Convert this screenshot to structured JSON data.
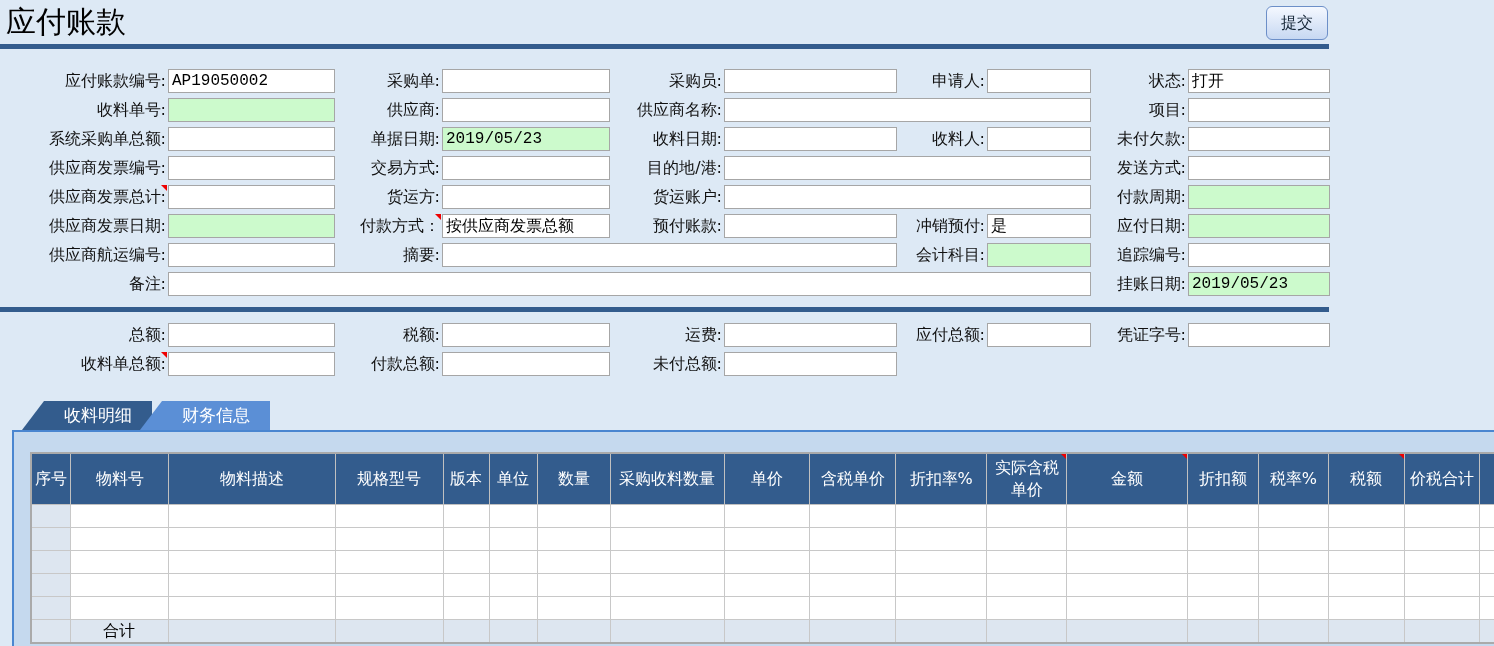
{
  "title": "应付账款",
  "submit_button": "提交",
  "form_rows": [
    [
      {
        "label": "应付账款编号:",
        "value": "AP19050002"
      },
      {
        "label": "采购单:"
      },
      {
        "label": "采购员:"
      },
      {
        "label": "申请人:"
      },
      {
        "label": "状态:",
        "value": "打开"
      }
    ],
    [
      {
        "label": "收料单号:",
        "highlight": true
      },
      {
        "label": "供应商:"
      },
      {
        "label": "供应商名称:"
      },
      {
        "label": "项目:"
      }
    ],
    [
      {
        "label": "系统采购单总额:"
      },
      {
        "label": "单据日期:",
        "value": "2019/05/23",
        "highlight": true
      },
      {
        "label": "收料日期:"
      },
      {
        "label": "收料人:"
      },
      {
        "label": "未付欠款:"
      }
    ],
    [
      {
        "label": "供应商发票编号:"
      },
      {
        "label": "交易方式:"
      },
      {
        "label": "目的地/港:"
      },
      {
        "label": "发送方式:"
      }
    ],
    [
      {
        "label": "供应商发票总计:",
        "flag": true
      },
      {
        "label": "货运方:"
      },
      {
        "label": "货运账户:"
      },
      {
        "label": "付款周期:",
        "highlight": true
      }
    ],
    [
      {
        "label": "供应商发票日期:",
        "highlight": true
      },
      {
        "label": "付款方式：",
        "value": "按供应商发票总额",
        "flag": true
      },
      {
        "label": "预付账款:"
      },
      {
        "label": "冲销预付:",
        "value": "是"
      },
      {
        "label": "应付日期:",
        "highlight": true
      }
    ],
    [
      {
        "label": "供应商航运编号:"
      },
      {
        "label": "摘要:"
      },
      {
        "label": "会计科目:",
        "highlight": true
      },
      {
        "label": "追踪编号:"
      }
    ],
    [
      {
        "label": "备注:"
      },
      {
        "label": "挂账日期:",
        "value": "2019/05/23",
        "highlight": true
      }
    ]
  ],
  "totals_rows": [
    [
      {
        "label": "总额:"
      },
      {
        "label": "税额:"
      },
      {
        "label": "运费:"
      },
      {
        "label": "应付总额:"
      },
      {
        "label": "凭证字号:"
      }
    ],
    [
      {
        "label": "收料单总额:",
        "flag": true
      },
      {
        "label": "付款总额:"
      },
      {
        "label": "未付总额:"
      }
    ]
  ],
  "tabs": [
    {
      "label": "收料明细",
      "selected": true
    },
    {
      "label": "财务信息",
      "selected": false
    }
  ],
  "table": {
    "columns": [
      {
        "label": "序号"
      },
      {
        "label": "物料号"
      },
      {
        "label": "物料描述"
      },
      {
        "label": "规格型号"
      },
      {
        "label": "版本"
      },
      {
        "label": "单位"
      },
      {
        "label": "数量"
      },
      {
        "label": "采购收料数量"
      },
      {
        "label": "单价"
      },
      {
        "label": "含税单价"
      },
      {
        "label": "折扣率%"
      },
      {
        "label": "实际含税单价",
        "flag": true
      },
      {
        "label": "金额",
        "flag": true
      },
      {
        "label": "折扣额"
      },
      {
        "label": "税率%"
      },
      {
        "label": "税额",
        "flag": true
      },
      {
        "label": "价税合计"
      }
    ],
    "footer_label": "合计"
  }
}
